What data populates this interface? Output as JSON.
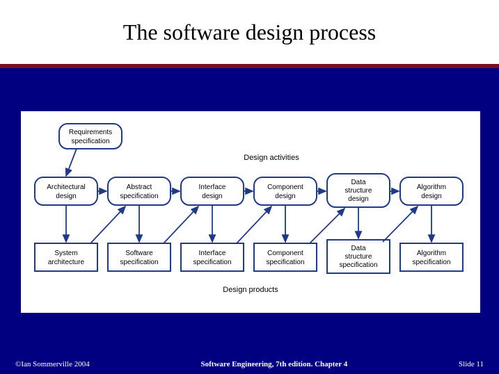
{
  "title": "The software design process",
  "footer": {
    "left": "©Ian Sommerville 2004",
    "mid": "Software Engineering, 7th edition. Chapter 4",
    "right": "Slide 11"
  },
  "labels": {
    "activities": "Design activities",
    "products": "Design products"
  },
  "input": {
    "l1": "Requirements",
    "l2": "specification"
  },
  "activities": [
    {
      "l1": "Architectural",
      "l2": "design"
    },
    {
      "l1": "Abstract",
      "l2": "specification"
    },
    {
      "l1": "Interface",
      "l2": "design"
    },
    {
      "l1": "Component",
      "l2": "design"
    },
    {
      "l1": "Data",
      "l2": "structure",
      "l3": "design"
    },
    {
      "l1": "Algorithm",
      "l2": "design"
    }
  ],
  "products": [
    {
      "l1": "System",
      "l2": "architecture"
    },
    {
      "l1": "Software",
      "l2": "specification"
    },
    {
      "l1": "Interface",
      "l2": "specification"
    },
    {
      "l1": "Component",
      "l2": "specification"
    },
    {
      "l1": "Data",
      "l2": "structure",
      "l3": "specification"
    },
    {
      "l1": "Algorithm",
      "l2": "specification"
    }
  ]
}
